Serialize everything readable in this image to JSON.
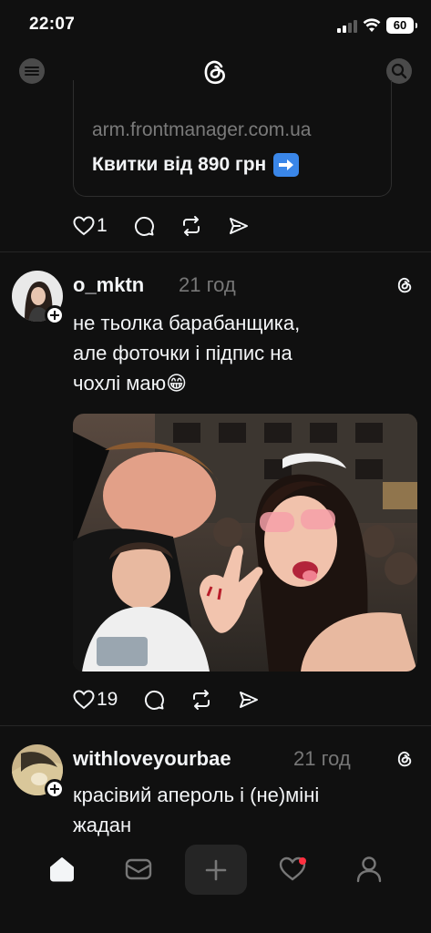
{
  "status_bar": {
    "time": "22:07",
    "battery": "60"
  },
  "header": {
    "logo": "threads-logo",
    "menu_icon": "menu-icon",
    "search_icon": "search-icon"
  },
  "link_card": {
    "domain": "arm.frontmanager.com.ua",
    "title": "Квитки від 890 грн",
    "emoji": "right-arrow-emoji"
  },
  "posts": [
    {
      "likes": "1"
    },
    {
      "username": "o_mktn",
      "time": "21 год",
      "text_lines": [
        "не тьолка барабанщика,",
        "але фоточки і підпис на",
        "чохлі маю😁"
      ],
      "likes": "19",
      "image": "selfie-photo-concert-crowd"
    },
    {
      "username": "withloveyourbae",
      "time": "21 год",
      "text_lines": [
        "красівий апероль і (не)міні",
        "жадан"
      ]
    }
  ],
  "bottom_nav": {
    "items": [
      "home-icon",
      "inbox-icon",
      "compose-icon",
      "activity-icon",
      "profile-icon"
    ],
    "activity_has_notification": true
  },
  "colors": {
    "background": "#101010",
    "text": "#f3f5f7",
    "muted": "#777777",
    "notification": "#ff3040"
  }
}
